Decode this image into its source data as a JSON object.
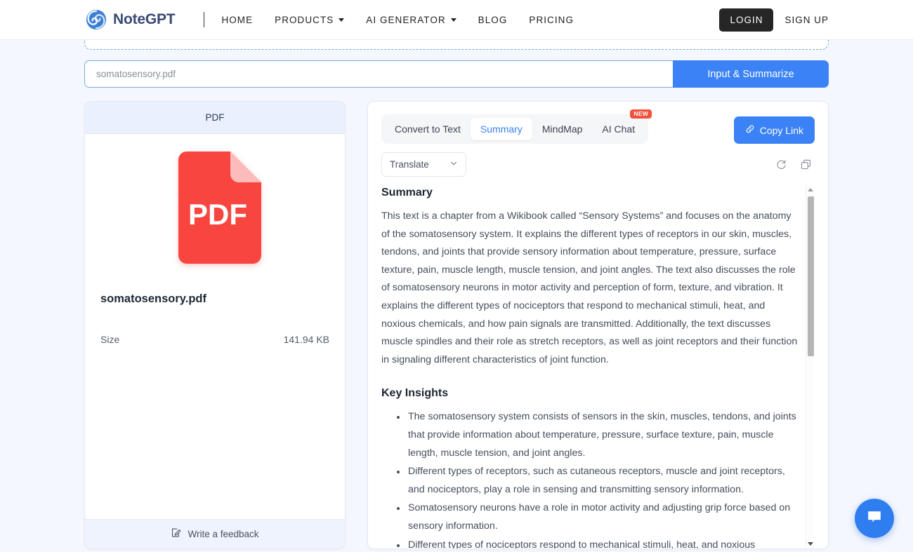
{
  "header": {
    "brand": "NoteGPT",
    "logo_icon": "spiral-logo-icon",
    "nav": [
      {
        "label": "HOME",
        "has_caret": false
      },
      {
        "label": "PRODUCTS",
        "has_caret": true
      },
      {
        "label": "AI GENERATOR",
        "has_caret": true
      },
      {
        "label": "BLOG",
        "has_caret": false
      },
      {
        "label": "PRICING",
        "has_caret": false
      }
    ],
    "login_label": "LOGIN",
    "signup_label": "SIGN UP"
  },
  "search": {
    "value": "somatosensory.pdf",
    "placeholder": "somatosensory.pdf",
    "button_label": "Input & Summarize"
  },
  "file_card": {
    "header_label": "PDF",
    "icon_label": "PDF",
    "file_name": "somatosensory.pdf",
    "size_label": "Size",
    "size_value": "141.94 KB",
    "feedback_label": "Write a feedback",
    "feedback_icon": "edit-note-icon"
  },
  "panel": {
    "tabs": [
      {
        "label": "Convert to Text",
        "active": false,
        "badge": ""
      },
      {
        "label": "Summary",
        "active": true,
        "badge": ""
      },
      {
        "label": "MindMap",
        "active": false,
        "badge": ""
      },
      {
        "label": "AI Chat",
        "active": false,
        "badge": "NEW"
      }
    ],
    "copy_link_label": "Copy Link",
    "copy_link_icon": "link-icon",
    "translate_label": "Translate",
    "refresh_icon": "refresh-icon",
    "copy_icon": "copy-icon",
    "summary_title": "Summary",
    "summary_text": "This text is a chapter from a Wikibook called “Sensory Systems” and focuses on the anatomy of the somatosensory system. It explains the different types of receptors in our skin, muscles, tendons, and joints that provide sensory information about temperature, pressure, surface texture, pain, muscle length, muscle tension, and joint angles. The text also discusses the role of somatosensory neurons in motor activity and perception of form, texture, and vibration. It explains the different types of nociceptors that respond to mechanical stimuli, heat, and noxious chemicals, and how pain signals are transmitted. Additionally, the text discusses muscle spindles and their role as stretch receptors, as well as joint receptors and their function in signaling different characteristics of joint function.",
    "insights_title": "Key Insights",
    "insights": [
      "The somatosensory system consists of sensors in the skin, muscles, tendons, and joints that provide information about temperature, pressure, surface texture, pain, muscle length, muscle tension, and joint angles.",
      "Different types of receptors, such as cutaneous receptors, muscle and joint receptors, and nociceptors, play a role in sensing and transmitting sensory information.",
      "Somatosensory neurons have a role in motor activity and adjusting grip force based on sensory information.",
      "Different types of nociceptors respond to mechanical stimuli, heat, and noxious"
    ]
  },
  "fab": {
    "icon": "chat-bubble-icon"
  },
  "colors": {
    "accent_blue": "#3b82f6",
    "pdf_red": "#f8453f",
    "badge_red": "#f4513c",
    "dark_button": "#262626",
    "page_bg": "#f4f7fd"
  }
}
